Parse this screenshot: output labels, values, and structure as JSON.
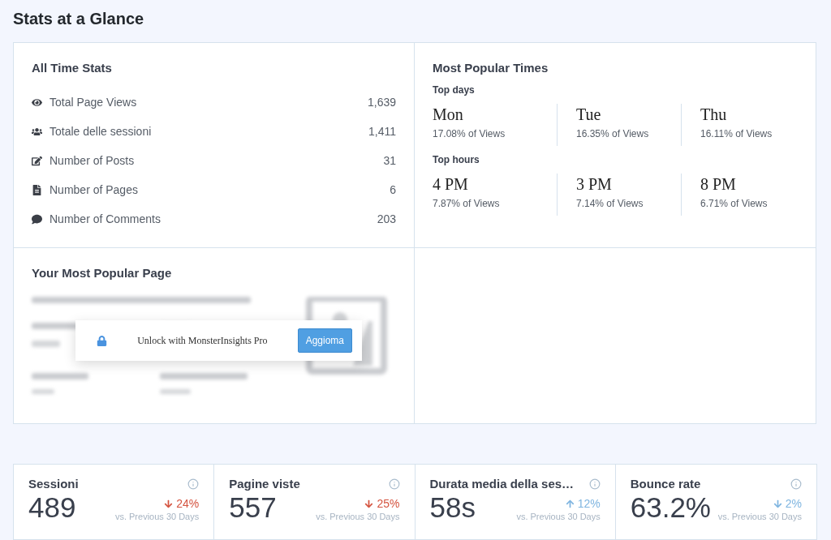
{
  "title": "Stats at a Glance",
  "all_time": {
    "title": "All Time Stats",
    "rows": [
      {
        "kind": "views",
        "label": "Total Page Views",
        "value": "1,639"
      },
      {
        "kind": "sessions",
        "label": "Totale delle sessioni",
        "value": "1,411"
      },
      {
        "kind": "posts",
        "label": "Number of Posts",
        "value": "31"
      },
      {
        "kind": "pages",
        "label": "Number of Pages",
        "value": "6"
      },
      {
        "kind": "comments",
        "label": "Number of Comments",
        "value": "203"
      }
    ]
  },
  "popular_times": {
    "title": "Most Popular Times",
    "groups": [
      {
        "label": "Top days",
        "items": [
          {
            "name": "Mon",
            "share": "17.08% of Views"
          },
          {
            "name": "Tue",
            "share": "16.35% of Views"
          },
          {
            "name": "Thu",
            "share": "16.11% of Views"
          }
        ]
      },
      {
        "label": "Top hours",
        "items": [
          {
            "name": "4 PM",
            "share": "7.87% of Views"
          },
          {
            "name": "3 PM",
            "share": "7.14% of Views"
          },
          {
            "name": "8 PM",
            "share": "6.71% of Views"
          }
        ]
      }
    ]
  },
  "popular_page": {
    "title": "Your Most Popular Page",
    "unlock_text": "Unlock with MonsterInsights Pro",
    "button": "Aggioma"
  },
  "metrics": [
    {
      "label": "Sessioni",
      "value": "489",
      "rising": false,
      "good": false,
      "change": "24%",
      "compare": "vs. Previous 30 Days"
    },
    {
      "label": "Pagine viste",
      "value": "557",
      "rising": false,
      "good": false,
      "change": "25%",
      "compare": "vs. Previous 30 Days"
    },
    {
      "label": "Durata media della ses…",
      "value": "58s",
      "rising": true,
      "good": true,
      "change": "12%",
      "compare": "vs. Previous 30 Days"
    },
    {
      "label": "Bounce rate",
      "value": "63.2%",
      "rising": false,
      "good": true,
      "change": "2%",
      "compare": "vs. Previous 30 Days"
    }
  ]
}
